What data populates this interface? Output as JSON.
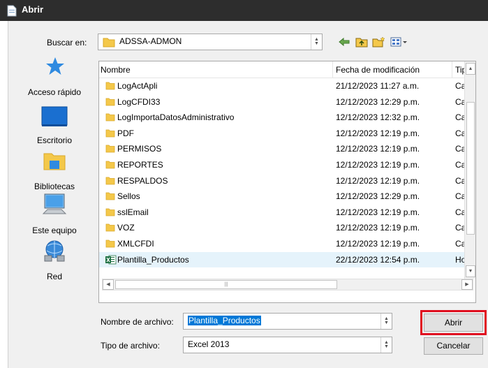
{
  "window": {
    "title": "Abrir"
  },
  "lookin": {
    "label": "Buscar en:",
    "value": "ADSSA-ADMON"
  },
  "toolbar": {
    "icons": [
      "back-arrow-icon",
      "up-folder-icon",
      "new-folder-icon",
      "view-menu-icon"
    ]
  },
  "places": [
    {
      "label": "Acceso rápido",
      "icon": "star-icon"
    },
    {
      "label": "Escritorio",
      "icon": "desktop-icon"
    },
    {
      "label": "Bibliotecas",
      "icon": "libraries-icon"
    },
    {
      "label": "Este equipo",
      "icon": "computer-icon"
    },
    {
      "label": "Red",
      "icon": "network-icon"
    }
  ],
  "columns": {
    "name": "Nombre",
    "date": "Fecha de modificación",
    "type": "Tip"
  },
  "files": [
    {
      "name": "LogActApli",
      "date": "21/12/2023 11:27 a.m.",
      "type": "Ca",
      "kind": "folder"
    },
    {
      "name": "LogCFDI33",
      "date": "12/12/2023 12:29 p.m.",
      "type": "Ca",
      "kind": "folder"
    },
    {
      "name": "LogImportaDatosAdministrativo",
      "date": "12/12/2023 12:32 p.m.",
      "type": "Ca",
      "kind": "folder"
    },
    {
      "name": "PDF",
      "date": "12/12/2023 12:19 p.m.",
      "type": "Ca",
      "kind": "folder"
    },
    {
      "name": "PERMISOS",
      "date": "12/12/2023 12:19 p.m.",
      "type": "Ca",
      "kind": "folder"
    },
    {
      "name": "REPORTES",
      "date": "12/12/2023 12:19 p.m.",
      "type": "Ca",
      "kind": "folder"
    },
    {
      "name": "RESPALDOS",
      "date": "12/12/2023 12:19 p.m.",
      "type": "Ca",
      "kind": "folder"
    },
    {
      "name": "Sellos",
      "date": "12/12/2023 12:29 p.m.",
      "type": "Ca",
      "kind": "folder"
    },
    {
      "name": "sslEmail",
      "date": "12/12/2023 12:19 p.m.",
      "type": "Ca",
      "kind": "folder"
    },
    {
      "name": "VOZ",
      "date": "12/12/2023 12:19 p.m.",
      "type": "Ca",
      "kind": "folder"
    },
    {
      "name": "XMLCFDI",
      "date": "12/12/2023 12:19 p.m.",
      "type": "Ca",
      "kind": "folder"
    },
    {
      "name": "Plantilla_Productos",
      "date": "22/12/2023 12:54 p.m.",
      "type": "Ho",
      "kind": "excel"
    }
  ],
  "filename": {
    "label": "Nombre de archivo:",
    "value": "Plantilla_Productos"
  },
  "filetype": {
    "label": "Tipo de archivo:",
    "value": "Excel 2013"
  },
  "buttons": {
    "open": "Abrir",
    "cancel": "Cancelar"
  },
  "colors": {
    "highlight": "#e01020",
    "selection": "#0078d7",
    "folder": "#f4c84a"
  }
}
